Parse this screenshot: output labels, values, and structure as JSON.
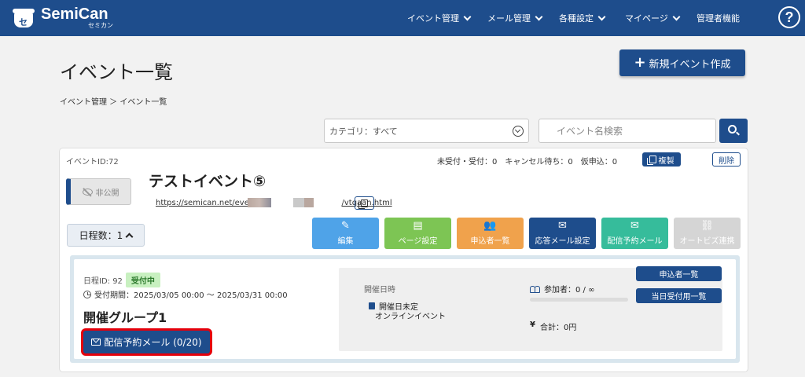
{
  "brand": {
    "name": "SemiCan",
    "sub": "セミカン",
    "mark": "セ"
  },
  "nav": [
    {
      "label": "イベント管理",
      "dropdown": true
    },
    {
      "label": "メール管理",
      "dropdown": true
    },
    {
      "label": "各種設定",
      "dropdown": true
    },
    {
      "label": "マイページ",
      "dropdown": true
    },
    {
      "label": "管理者機能",
      "dropdown": false
    }
  ],
  "help_label": "?",
  "page": {
    "title": "イベント一覧",
    "new_button": "新規イベント作成",
    "new_button_icon": "+",
    "breadcrumb": "イベント管理 ＞ イベント一覧"
  },
  "filters": {
    "category": "カテゴリ：すべて",
    "search_placeholder": "イベント名検索"
  },
  "event": {
    "id_label": "イベントID:72",
    "counts": "未受付・受付：0　キャンセル待ち：0　仮申込：0",
    "copy_button": "複製",
    "delete_button": "削除",
    "visibility": "非公開",
    "title": "テストイベント⑤",
    "url_start": "https://semican.net/event/",
    "url_end": "/vtqaan.html",
    "days_label": "日程数：1",
    "actions": [
      {
        "label": "編集",
        "icon": "✎",
        "icon_name": "pencil-icon",
        "color": "#4fa3e8"
      },
      {
        "label": "ページ設定",
        "icon": "▤",
        "icon_name": "page-icon",
        "color": "#7dc554"
      },
      {
        "label": "申込者一覧",
        "icon": "👥",
        "icon_name": "users-icon",
        "color": "#f0a24c"
      },
      {
        "label": "応答メール設定",
        "icon": "✉",
        "icon_name": "reply-mail-icon",
        "color": "#1e4d8c"
      },
      {
        "label": "配信予約メール",
        "icon": "✉",
        "icon_name": "mail-icon",
        "color": "#36bc9b"
      },
      {
        "label": "オートビズ連携",
        "icon": "⛓",
        "icon_name": "link-off-icon",
        "color": "#d5d5d5"
      }
    ],
    "group": {
      "id_label": "日程ID: 92",
      "status": "受付中",
      "period": "受付期間：2025/03/05 00:00 ～ 2025/03/31 00:00",
      "name": "開催グループ1",
      "mail_button": "配信予約メール (0/20)",
      "date_label": "開催日時",
      "date_value": "開催日未定",
      "venue": "オンラインイベント",
      "participants": "参加者：0 / ∞",
      "participants_progress": 0,
      "total_yen": "¥",
      "total": "合計：0円",
      "applicants_button": "申込者一覧",
      "reception_button": "当日受付用一覧"
    }
  }
}
